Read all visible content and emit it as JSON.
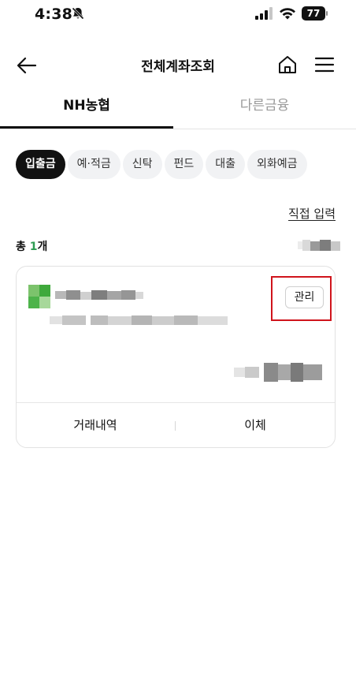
{
  "status_bar": {
    "time": "4:38",
    "battery": "77"
  },
  "header": {
    "title": "전체계좌조회"
  },
  "tabs": [
    {
      "label": "NH농협"
    },
    {
      "label": "다른금융"
    }
  ],
  "filters": [
    {
      "label": "입출금"
    },
    {
      "label": "예·적금"
    },
    {
      "label": "신탁"
    },
    {
      "label": "펀드"
    },
    {
      "label": "대출"
    },
    {
      "label": "외화예금"
    }
  ],
  "direct_input": "직접 입력",
  "summary": {
    "prefix": "총 ",
    "count": "1",
    "suffix": "개"
  },
  "account_card": {
    "manage_label": "관리",
    "history_label": "거래내역",
    "transfer_label": "이체"
  },
  "colors": {
    "accent_green": "#2e9b52",
    "highlight_red": "#d0141c",
    "chip_active": "#111111"
  }
}
